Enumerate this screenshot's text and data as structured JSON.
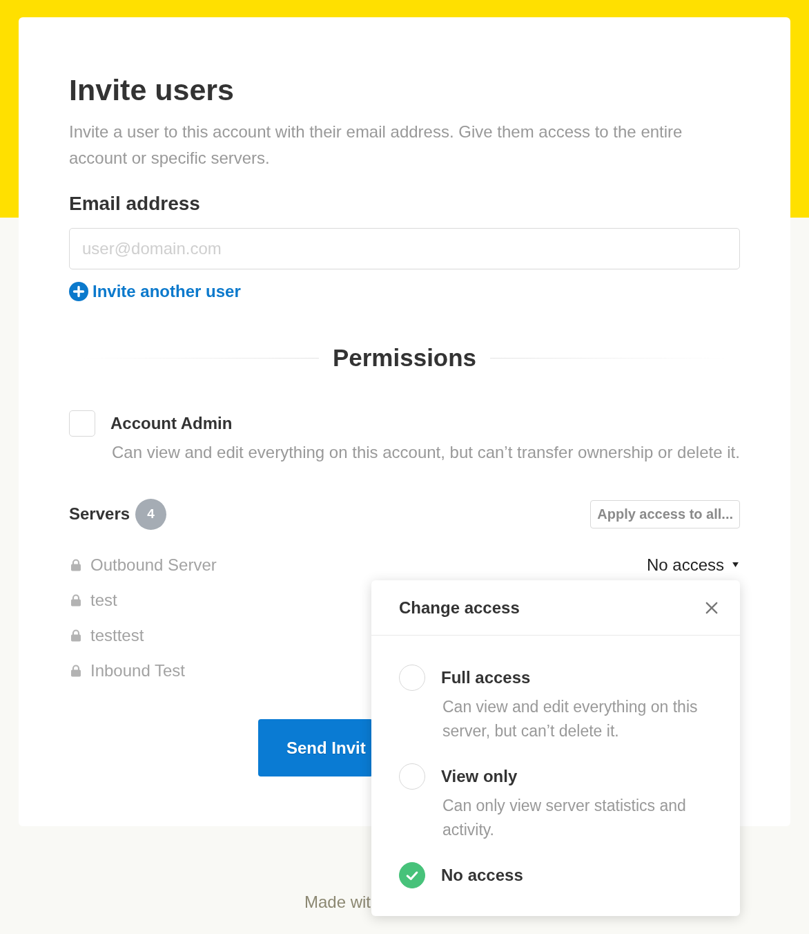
{
  "header": {
    "title": "Invite users",
    "description": "Invite a user to this account with their email address. Give them access to the entire account or specific servers."
  },
  "email_field": {
    "label": "Email address",
    "placeholder": "user@domain.com"
  },
  "invite_another_link": "Invite another user",
  "permissions": {
    "heading": "Permissions",
    "account_admin": {
      "label": "Account Admin",
      "description": "Can view and edit everything on this account, but can’t transfer ownership or delete it.",
      "checked": false
    }
  },
  "servers": {
    "heading": "Servers",
    "count": "4",
    "apply_button": "Apply access to all...",
    "items": [
      {
        "name": "Outbound Server",
        "access": "No access"
      },
      {
        "name": "test"
      },
      {
        "name": "testtest"
      },
      {
        "name": "Inbound Test"
      }
    ]
  },
  "send_button": "Send Invit",
  "footer": "Made wit",
  "access_popover": {
    "title": "Change access",
    "options": [
      {
        "label": "Full access",
        "description": "Can view and edit everything on this server, but can’t delete it.",
        "selected": false
      },
      {
        "label": "View only",
        "description": "Can only view server statistics and activity.",
        "selected": false
      },
      {
        "label": "No access",
        "selected": true
      }
    ]
  }
}
